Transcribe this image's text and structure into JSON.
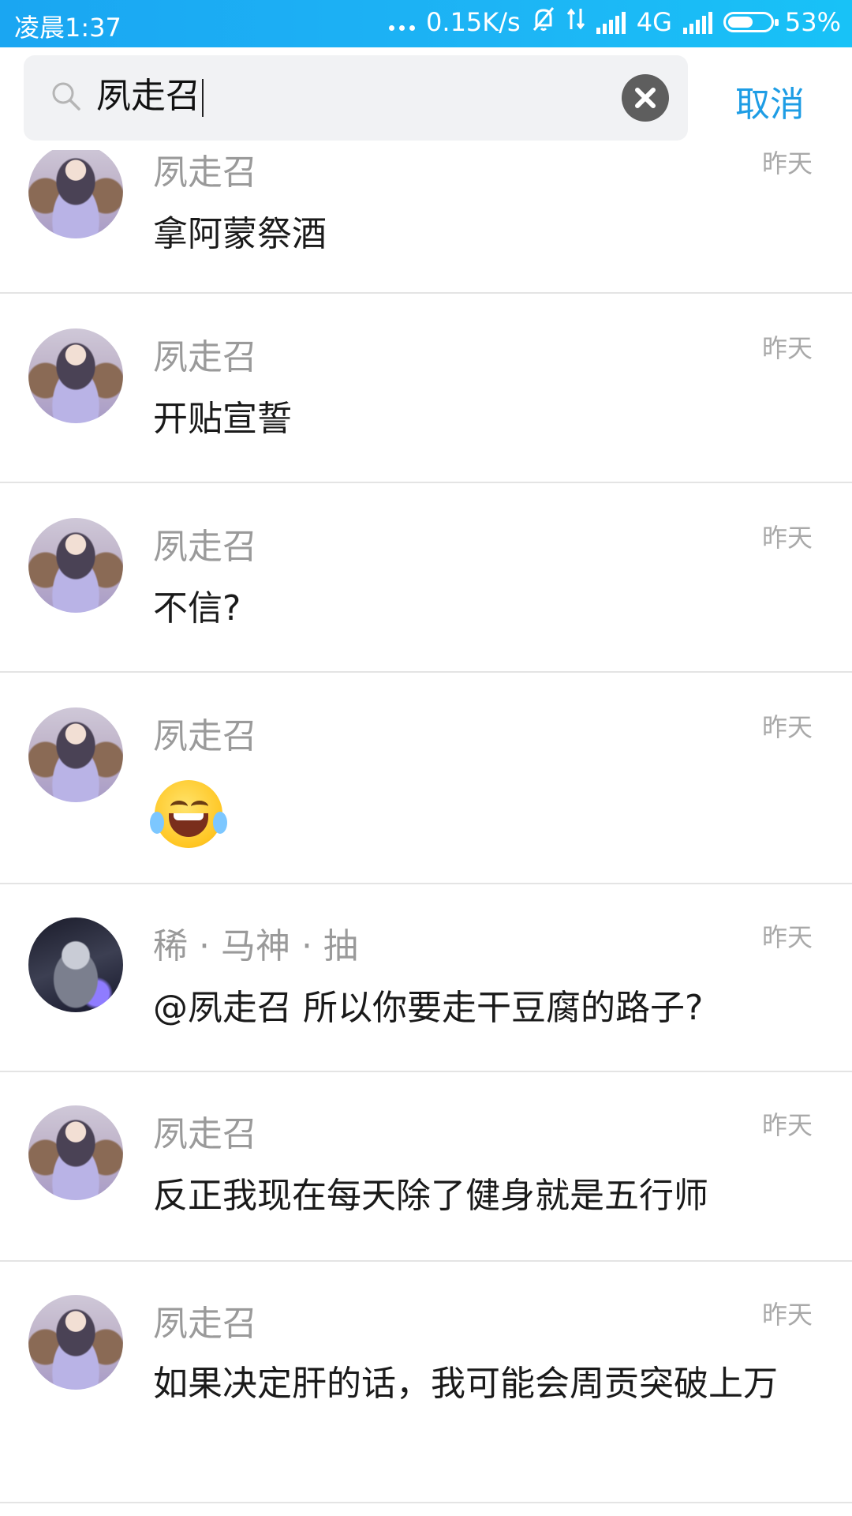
{
  "status_bar": {
    "time": "凌晨1:37",
    "net_speed": "0.15K/s",
    "network": "4G",
    "battery": "53%"
  },
  "search": {
    "query": "夙走召",
    "cancel_label": "取消"
  },
  "results": [
    {
      "name": "夙走召",
      "time": "昨天",
      "message": "拿阿蒙祭酒",
      "avatar": "girl"
    },
    {
      "name": "夙走召",
      "time": "昨天",
      "message": "开贴宣誓",
      "avatar": "girl"
    },
    {
      "name": "夙走召",
      "time": "昨天",
      "message": "不信?",
      "avatar": "girl"
    },
    {
      "name": "夙走召",
      "time": "昨天",
      "message": "",
      "emoji": "tears-of-joy",
      "avatar": "girl"
    },
    {
      "name": "稀 · 马神 · 抽",
      "time": "昨天",
      "message": "@夙走召 所以你要走干豆腐的路子?",
      "avatar": "knight"
    },
    {
      "name": "夙走召",
      "time": "昨天",
      "message": "反正我现在每天除了健身就是五行师",
      "avatar": "girl"
    },
    {
      "name": "夙走召",
      "time": "昨天",
      "message": "如果决定肝的话，我可能会周贡突破上万",
      "avatar": "girl"
    }
  ]
}
